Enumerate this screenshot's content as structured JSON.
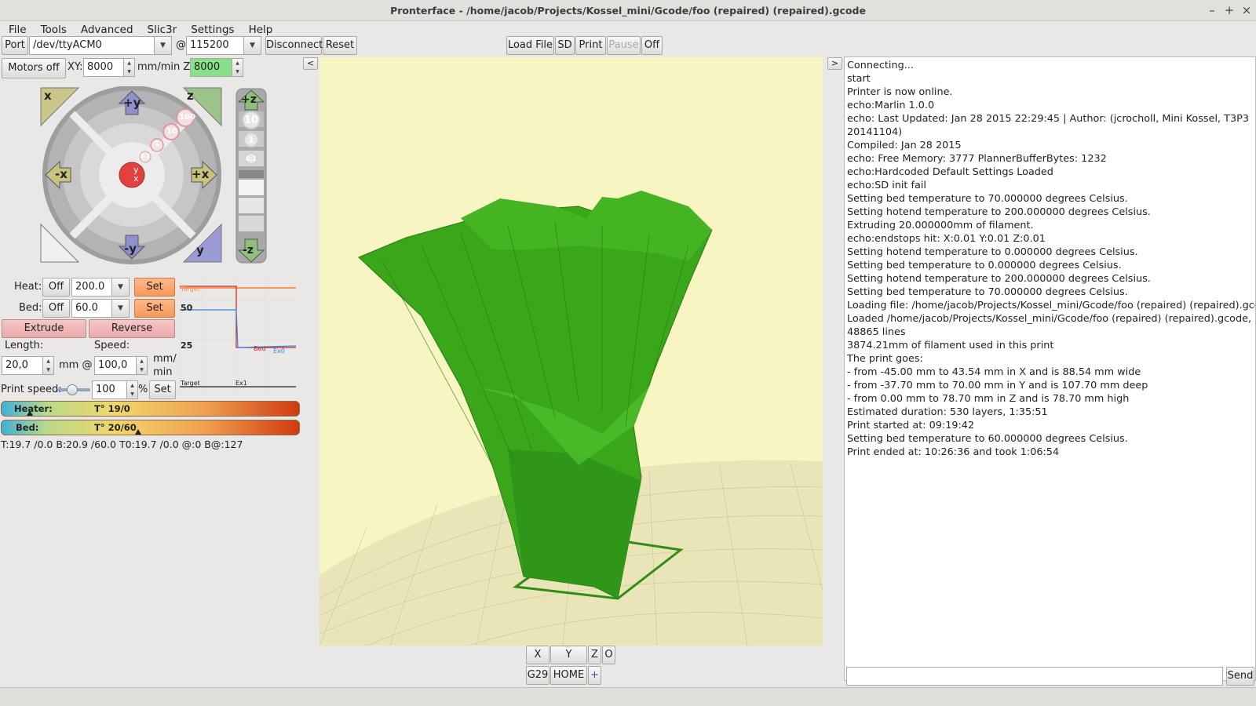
{
  "window": {
    "title": "Pronterface - /home/jacob/Projects/Kossel_mini/Gcode/foo (repaired) (repaired).gcode",
    "min": "–",
    "max": "+",
    "close": "×"
  },
  "menu": [
    "File",
    "Tools",
    "Advanced",
    "Slic3r",
    "Settings",
    "Help"
  ],
  "toolbar": {
    "port_label": "Port",
    "port_value": "/dev/ttyACM0",
    "at": "@",
    "baud_value": "115200",
    "disconnect": "Disconnect",
    "reset": "Reset",
    "load_file": "Load File",
    "sd": "SD",
    "print": "Print",
    "pause": "Pause",
    "off": "Off"
  },
  "motion": {
    "motors_off": "Motors off",
    "xy_label": "XY:",
    "xy_value": "8000",
    "unit_z_label": "mm/min Z:",
    "z_value": "8000",
    "collapse": "<"
  },
  "jog": {
    "home_x": "x",
    "home_z": "z",
    "home_y": "y",
    "plus_y": "+y",
    "minus_y": "-y",
    "minus_x": "-x",
    "plus_x": "+x",
    "steps": [
      "100",
      "10",
      "1",
      "0.1"
    ],
    "center_y": "y",
    "center_x": "x",
    "plus_z": "+z",
    "minus_z": "-z",
    "z_steps": [
      "10",
      "1",
      "0.1"
    ]
  },
  "temps": {
    "heat_label": "Heat:",
    "heat_off": "Off",
    "heat_value": "200.0",
    "heat_set": "Set",
    "bed_label": "Bed:",
    "bed_off": "Off",
    "bed_value": "60.0",
    "bed_set": "Set"
  },
  "extrude": {
    "extrude": "Extrude",
    "reverse": "Reverse",
    "length_label": "Length:",
    "speed_label": "Speed:",
    "length_value": "20,0",
    "mm_at": "mm @",
    "speed_value": "100,0",
    "unit_1": "mm/",
    "unit_2": "min"
  },
  "print_speed": {
    "label": "Print speed:",
    "value": "100",
    "pct": "%",
    "set": "Set",
    "slider_fraction": 0.45
  },
  "graph": {
    "y_ticks": [
      "50",
      "25"
    ],
    "labels": [
      "Target",
      "Bed",
      "Ex0",
      "Target",
      "Ex1"
    ]
  },
  "gauges": {
    "heater_label": "Heater:",
    "heater_text": "T° 19/0",
    "heater_fraction": 0.095,
    "bed_label": "Bed:",
    "bed_text": "T° 20/60",
    "bed_fraction": 0.34
  },
  "status_line": "T:19.7 /0.0 B:20.9 /60.0 T0:19.7 /0.0 @:0 B@:127",
  "viewer_buttons": {
    "x": "X",
    "y": "Y",
    "z": "Z",
    "o": "O",
    "g29": "G29",
    "home": "HOME",
    "plus": "+"
  },
  "console_toggle": ">",
  "console_lines": [
    "Connecting...",
    "start",
    "Printer is now online.",
    "echo:Marlin 1.0.0",
    "echo: Last Updated: Jan 28 2015 22:29:45 | Author: (jcrocholl, Mini Kossel, T3P3",
    "20141104)",
    "Compiled: Jan 28 2015",
    "echo: Free Memory: 3777  PlannerBufferBytes: 1232",
    "echo:Hardcoded Default Settings Loaded",
    "echo:SD init fail",
    "Setting bed temperature to 70.000000 degrees Celsius.",
    "Setting hotend temperature to 200.000000 degrees Celsius.",
    "Extruding 20.000000mm of filament.",
    "echo:endstops hit:  X:0.01 Y:0.01 Z:0.01",
    "Setting hotend temperature to 0.000000 degrees Celsius.",
    "Setting bed temperature to 0.000000 degrees Celsius.",
    "Setting hotend temperature to 200.000000 degrees Celsius.",
    "Setting bed temperature to 70.000000 degrees Celsius.",
    "Loading file: /home/jacob/Projects/Kossel_mini/Gcode/foo (repaired) (repaired).gcode",
    "Loaded /home/jacob/Projects/Kossel_mini/Gcode/foo (repaired) (repaired).gcode,",
    "48865 lines",
    "3874.21mm of filament used in this print",
    "The print goes:",
    "- from -45.00 mm to 43.54 mm in X and is 88.54 mm wide",
    "- from -37.70 mm to 70.00 mm in Y and is 107.70 mm deep",
    "- from 0.00 mm to 78.70 mm in Z and is 78.70 mm high",
    "Estimated duration: 530 layers, 1:35:51",
    "Print started at: 09:19:42",
    "Setting bed temperature to 60.000000 degrees Celsius.",
    "Print ended at: 10:26:36 and took 1:06:54"
  ],
  "send": "Send",
  "colors": {
    "model": "#3aa61a",
    "viewport_bg": "#f7f6c2",
    "accent": "#f79858"
  }
}
